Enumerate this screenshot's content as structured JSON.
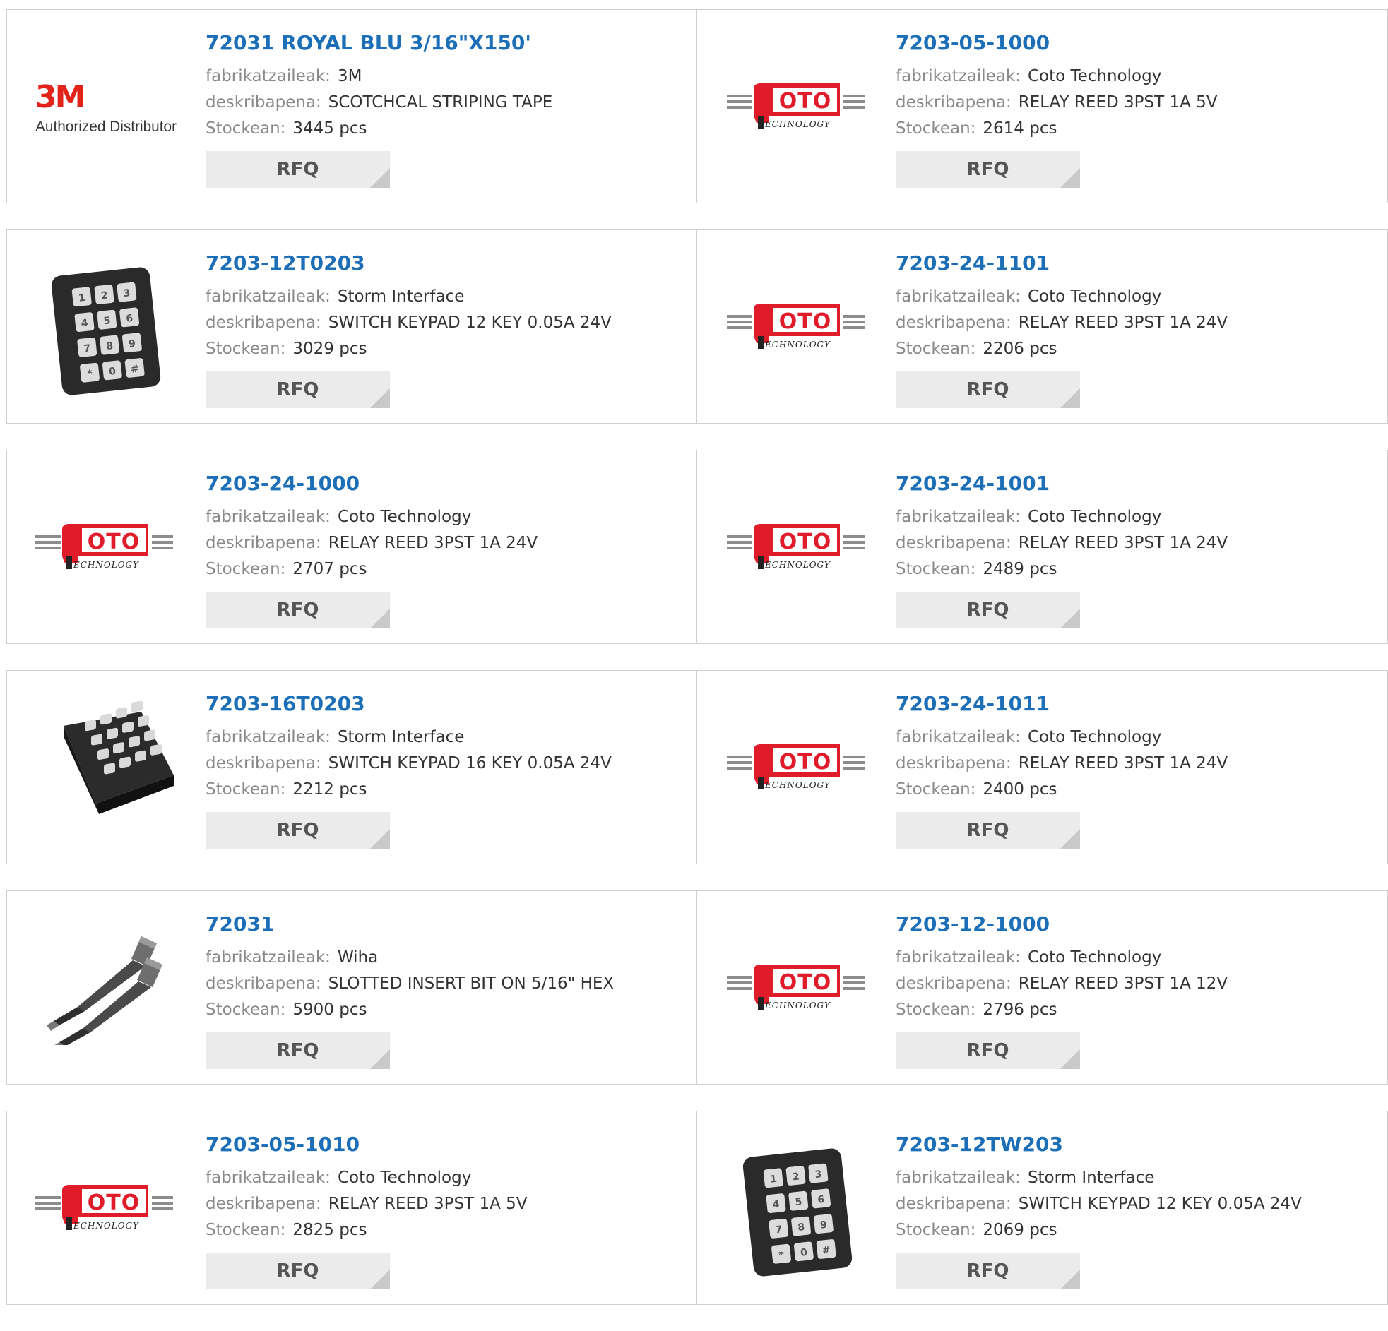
{
  "labels": {
    "manufacturer": "fabrikatzaileak:",
    "description": "deskribapena:",
    "stock": "Stockean:",
    "rfq": "RFQ"
  },
  "logos": {
    "threem_mark": "3M",
    "threem_sub": "Authorized Distributor",
    "coto_mark": "OTO",
    "coto_sub": "ECHNOLOGY"
  },
  "colors": {
    "link": "#1c6eb7",
    "coto_red": "#e01b2a",
    "threem_red": "#e2231a"
  },
  "products": [
    {
      "part": "72031 ROYAL BLU 3/16\"X150'",
      "manufacturer": "3M",
      "description": "SCOTCHCAL STRIPING TAPE",
      "stock": "3445 pcs",
      "image": "3m-logo"
    },
    {
      "part": "7203-05-1000",
      "manufacturer": "Coto Technology",
      "description": "RELAY REED 3PST 1A 5V",
      "stock": "2614 pcs",
      "image": "coto-logo"
    },
    {
      "part": "7203-12T0203",
      "manufacturer": "Storm Interface",
      "description": "SWITCH KEYPAD 12 KEY 0.05A 24V",
      "stock": "3029 pcs",
      "image": "keypad-12"
    },
    {
      "part": "7203-24-1101",
      "manufacturer": "Coto Technology",
      "description": "RELAY REED 3PST 1A 24V",
      "stock": "2206 pcs",
      "image": "coto-logo"
    },
    {
      "part": "7203-24-1000",
      "manufacturer": "Coto Technology",
      "description": "RELAY REED 3PST 1A 24V",
      "stock": "2707 pcs",
      "image": "coto-logo"
    },
    {
      "part": "7203-24-1001",
      "manufacturer": "Coto Technology",
      "description": "RELAY REED 3PST 1A 24V",
      "stock": "2489 pcs",
      "image": "coto-logo"
    },
    {
      "part": "7203-16T0203",
      "manufacturer": "Storm Interface",
      "description": "SWITCH KEYPAD 16 KEY 0.05A 24V",
      "stock": "2212 pcs",
      "image": "keypad-16"
    },
    {
      "part": "7203-24-1011",
      "manufacturer": "Coto Technology",
      "description": "RELAY REED 3PST 1A 24V",
      "stock": "2400 pcs",
      "image": "coto-logo"
    },
    {
      "part": "72031",
      "manufacturer": "Wiha",
      "description": "SLOTTED INSERT BIT ON 5/16\" HEX",
      "stock": "5900 pcs",
      "image": "screwdriver-bits"
    },
    {
      "part": "7203-12-1000",
      "manufacturer": "Coto Technology",
      "description": "RELAY REED 3PST 1A 12V",
      "stock": "2796 pcs",
      "image": "coto-logo"
    },
    {
      "part": "7203-05-1010",
      "manufacturer": "Coto Technology",
      "description": "RELAY REED 3PST 1A 5V",
      "stock": "2825 pcs",
      "image": "coto-logo"
    },
    {
      "part": "7203-12TW203",
      "manufacturer": "Storm Interface",
      "description": "SWITCH KEYPAD 12 KEY 0.05A 24V",
      "stock": "2069 pcs",
      "image": "keypad-12"
    }
  ]
}
